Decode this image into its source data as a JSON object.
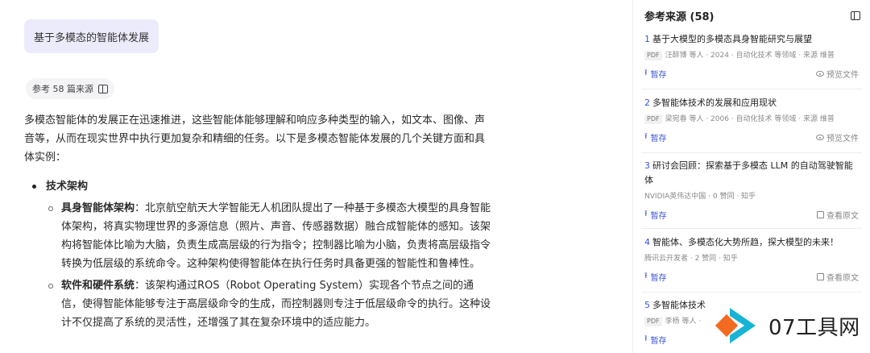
{
  "query": "基于多模态的智能体发展",
  "ref_chip": {
    "label": "参考 58 篇来源",
    "icon": "book-icon"
  },
  "answer": {
    "intro": "多模态智能体的发展正在迅速推进，这些智能体能够理解和响应多种类型的输入，如文本、图像、声音等，从而在现实世界中执行更加复杂和精细的任务。以下是多模态智能体发展的几个关键方面和具体实例：",
    "section_title": "技术架构",
    "items": [
      {
        "title": "具身智能体架构",
        "text": "：北京航空航天大学智能无人机团队提出了一种基于多模态大模型的具身智能体架构，将真实物理世界的多源信息（照片、声音、传感器数据）融合成智能体的感知。该架构将智能体比喻为大脑，负责生成高层级的行为指令；控制器比喻为小脑，负责将高层级指令转换为低层级的系统命令。这种架构使得智能体在执行任务时具备更强的智能性和鲁棒性。"
      },
      {
        "title": "软件和硬件系统",
        "text": "：该架构通过ROS（Robot Operating System）实现各个节点之间的通信，使得智能体能够专注于高层级命令的生成，而控制器则专注于低层级命令的执行。这种设计不仅提高了系统的灵活性，还增强了其在复杂环境中的适应能力。"
      }
    ]
  },
  "sidebar": {
    "title": "参考来源 (58)",
    "panel_icon": "panel-icon",
    "save_label": "暂存",
    "preview_label": "预览文件",
    "open_label": "查看原文",
    "sources": [
      {
        "num": "1",
        "title": "基于大模型的多模态具身智能研究与展望",
        "pdf": "PDF",
        "meta": "汪醉博 等人 · 2024 · 自动化技术 等领域 · 来源 维普",
        "action": "preview"
      },
      {
        "num": "2",
        "title": "多智能体技术的发展和应用现状",
        "pdf": "PDF",
        "meta": "梁宛春 等人 · 2006 · 自动化技术 等领域 · 来源 维普",
        "action": "preview"
      },
      {
        "num": "3",
        "title": "研讨会回顾：探索基于多模态 LLM 的自动驾驶智能体",
        "pdf": "",
        "meta": "NVIDIA英伟达中国 · 0 赞同 · 知乎",
        "action": "open"
      },
      {
        "num": "4",
        "title": "智能体、多模态化大势所趋，探大模型的未来！",
        "pdf": "",
        "meta": "腾讯云开发者 · 2 赞同 · 知乎",
        "action": "open"
      },
      {
        "num": "5",
        "title": "多智能体技术",
        "pdf": "PDF",
        "meta": "李杨 等人 ·",
        "action": "none"
      }
    ]
  },
  "watermark": {
    "text": "07工具网",
    "colors": {
      "cyan": "#17b4d4",
      "orange": "#f26b21"
    }
  }
}
